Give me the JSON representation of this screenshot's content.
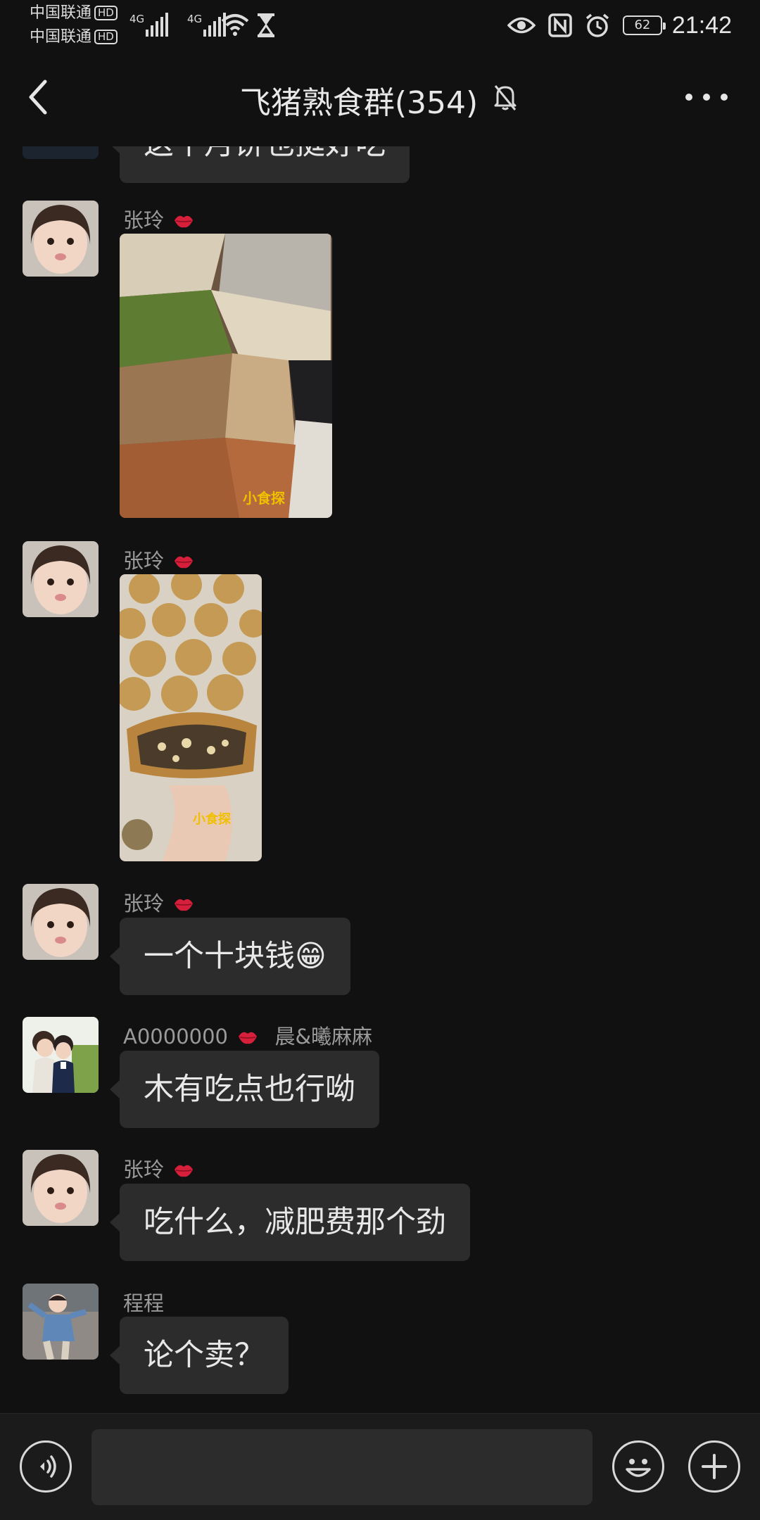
{
  "status_bar": {
    "carrier_1": "中国联通",
    "carrier_2": "中国联通",
    "hd_badge": "HD",
    "network_1": "4G",
    "network_2": "4G",
    "battery": "62",
    "time": "21:42"
  },
  "nav": {
    "title": "飞猪熟食群(354)"
  },
  "messages": [
    {
      "type": "text",
      "text": "这个月饼也挺好吃"
    },
    {
      "type": "image",
      "sender": "张玲",
      "watermark": "小食探"
    },
    {
      "type": "image",
      "sender": "张玲",
      "watermark": "小食探"
    },
    {
      "type": "text",
      "sender": "张玲",
      "text": "一个十块钱😁"
    },
    {
      "type": "text",
      "sender": "A0000000",
      "sender_extra": "晨&曦麻麻",
      "text": "木有吃点也行呦"
    },
    {
      "type": "text",
      "sender": "张玲",
      "text": "吃什么，减肥费那个劲"
    },
    {
      "type": "text",
      "sender": "程程",
      "text": "论个卖？"
    }
  ],
  "input": {
    "placeholder": ""
  },
  "icons": [
    "back-arrow-icon",
    "bell-muted-icon",
    "more-dots-icon",
    "voice-icon",
    "emoji-icon",
    "plus-icon",
    "eye-icon",
    "nfc-icon",
    "alarm-icon",
    "wifi-icon",
    "hourglass-icon",
    "lips-icon"
  ],
  "colors": {
    "background": "#111111",
    "bubble": "#2c2c2c",
    "sender_text": "#9a9a9a",
    "kiss_red": "#d61f3a"
  }
}
